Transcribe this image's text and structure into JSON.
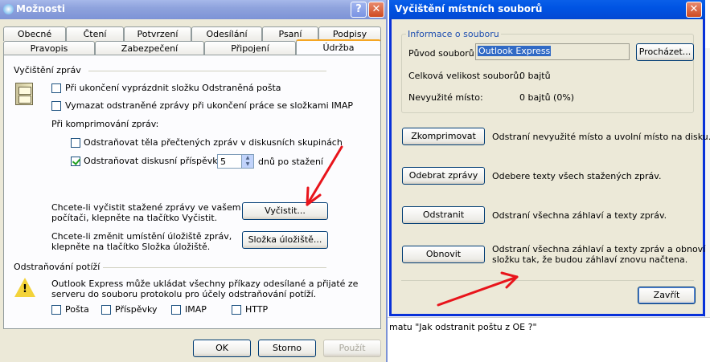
{
  "options_window": {
    "title": "Možnosti",
    "tabs_row1": [
      "Obecné",
      "Čtení",
      "Potvrzení",
      "Odesílání",
      "Psaní",
      "Podpisy"
    ],
    "tabs_row2": [
      "Pravopis",
      "Zabezpečení",
      "Připojení",
      "Údržba"
    ],
    "section_cleanup": "Vyčištění zpráv",
    "cb_empty_deleted": "Při ukončení vyprázdnit složku Odstraněná pošta",
    "cb_purge_imap": "Vymazat odstraněné zprávy při ukončení práce se složkami IMAP",
    "compacting_label": "Při komprimování zpráv:",
    "cb_remove_bodies": "Odstraňovat těla přečtených zpráv v diskusních skupinách",
    "cb_remove_posts": "Odstraňovat diskusní příspěvky",
    "days_value": "5",
    "days_suffix": "dnů po stažení",
    "clean_text_line1": "Chcete-li vyčistit stažené zprávy ve vašem",
    "clean_text_line2": "počítači, klepněte na tlačítko Vyčistit.",
    "clean_button": "Vyčistit...",
    "store_text_line1": "Chcete-li změnit umístění úložiště zpráv,",
    "store_text_line2": "klepněte na tlačítko Složka úložiště.",
    "store_button": "Složka úložiště...",
    "section_troubleshoot": "Odstraňování potíží",
    "troubleshoot_line1": "Outlook Express může ukládat všechny příkazy odesílané a přijaté ze",
    "troubleshoot_line2": "serveru do souboru protokolu pro účely odstraňování potíží.",
    "log_options": [
      "Pošta",
      "Příspěvky",
      "IMAP",
      "HTTP"
    ],
    "ok_button": "OK",
    "cancel_button": "Storno",
    "apply_button": "Použít"
  },
  "cleanup_window": {
    "title": "Vyčištění místních souborů",
    "info_legend": "Informace o souboru",
    "source_label": "Původ souborů:",
    "source_value": "Outlook Express",
    "browse_button": "Procházet...",
    "total_size_label": "Celková velikost souborů:",
    "total_size_value": "0 bajtů",
    "unused_label": "Nevyužité místo:",
    "unused_value": "0 bajtů (0%)",
    "compact_button": "Zkomprimovat",
    "compact_desc": "Odstraní nevyužité místo a uvolní místo na disku.",
    "remove_button": "Odebrat zprávy",
    "remove_desc": "Odebere texty všech stažených zpráv.",
    "delete_button": "Odstranit",
    "delete_desc": "Odstraní všechna záhlaví a texty zpráv.",
    "reset_button": "Obnovit",
    "reset_desc_line1": "Odstraní všechna záhlaví a texty zpráv a obnoví",
    "reset_desc_line2": "složku tak, že budou záhlaví znovu načtena.",
    "close_button": "Zavřít"
  },
  "background": {
    "status_text": "matu \"Jak odstranit poštu z OE ?\""
  },
  "colors": {
    "accent_arrow": "#e8141b",
    "title_active": "#3a62cf",
    "dialog_face": "#ece9d8",
    "link_blue": "#1f4fb0"
  }
}
